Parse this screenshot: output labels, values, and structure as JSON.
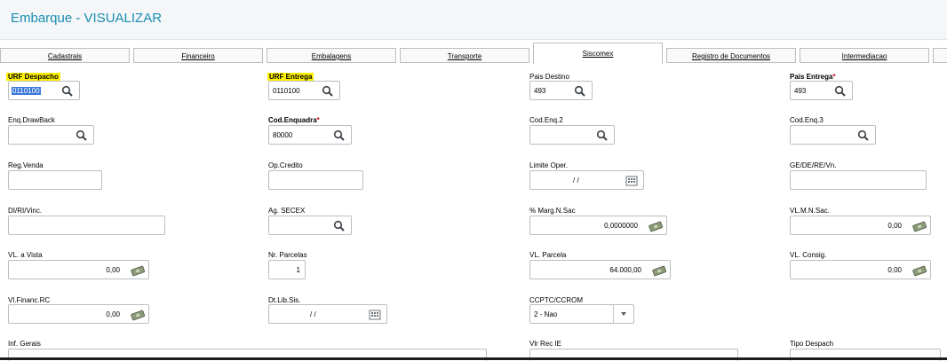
{
  "title": "Embarque - VISUALIZAR",
  "tabs": [
    "Cadastrais",
    "Financeiro",
    "Embalagens",
    "Transporte",
    "Siscomex",
    "Registro de Documentos",
    "Intermediacao"
  ],
  "fields": {
    "urf_despacho": {
      "label": "URF Despacho",
      "value": "0110100"
    },
    "urf_entrega": {
      "label": "URF Entrega",
      "value": "0110100"
    },
    "pais_destino": {
      "label": "Pais Destino",
      "value": "493"
    },
    "pais_entrega": {
      "label": "Pais Entrega",
      "value": "493"
    },
    "enq_drawback": {
      "label": "Enq.DrawBack",
      "value": ""
    },
    "cod_enquadra": {
      "label": "Cod.Enquadra",
      "value": "80000"
    },
    "cod_enq2": {
      "label": "Cod.Enq.2",
      "value": ""
    },
    "cod_enq3": {
      "label": "Cod.Enq.3",
      "value": ""
    },
    "reg_venda": {
      "label": "Reg.Venda",
      "value": ""
    },
    "op_credito": {
      "label": "Op.Credito",
      "value": ""
    },
    "limite_oper": {
      "label": "Limite Oper.",
      "value": "/ /"
    },
    "ge_de_re": {
      "label": "GE/DE/RE/Vn.",
      "value": ""
    },
    "di_ri_vinc": {
      "label": "DI/RI/Vinc.",
      "value": ""
    },
    "ag_secex": {
      "label": "Ag. SECEX",
      "value": ""
    },
    "marg_n_sac": {
      "label": "% Marg.N.Sac",
      "value": "0,0000000"
    },
    "vl_mn_sac": {
      "label": "VL.M.N.Sac.",
      "value": "0,00"
    },
    "vl_vista": {
      "label": "VL. a Vista",
      "value": "0,00"
    },
    "nr_parcelas": {
      "label": "Nr. Parcelas",
      "value": "1"
    },
    "vl_parcela": {
      "label": "VL. Parcela",
      "value": "64.000,00"
    },
    "vl_consig": {
      "label": "VL. Consig.",
      "value": "0,00"
    },
    "vl_financ_rc": {
      "label": "Vl.Financ.RC",
      "value": "0,00"
    },
    "dt_lib_sis": {
      "label": "Dt.Lib.Sis.",
      "value": "/ /"
    },
    "ccptc_ccrom": {
      "label": "CCPTC/CCROM",
      "value": "2 - Nao"
    },
    "inf_gerais": {
      "label": "Inf. Gerais",
      "value": ""
    },
    "vlr_rec_ie": {
      "label": "Vlr Rec IE",
      "value": ""
    },
    "tipo_despach": {
      "label": "Tipo Despach",
      "value": ""
    }
  }
}
